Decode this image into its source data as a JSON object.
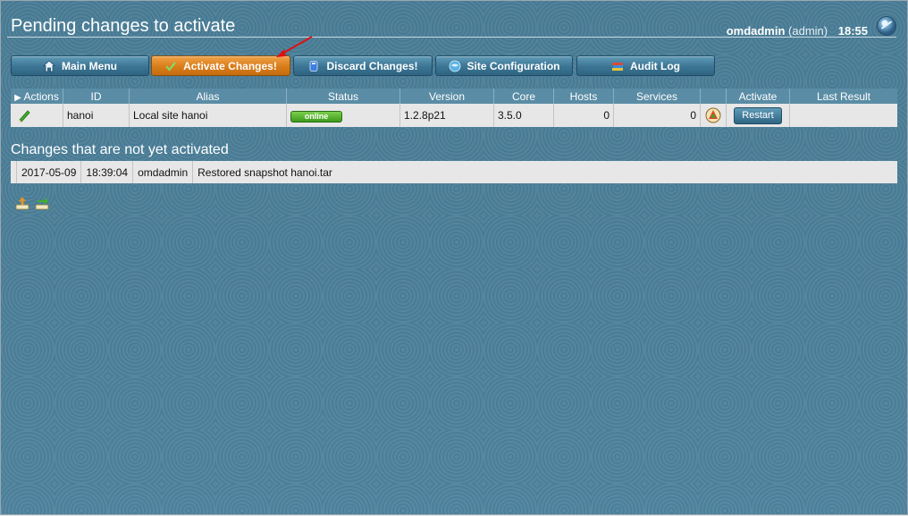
{
  "page": {
    "title": "Pending changes to activate",
    "user": "omdadmin",
    "role": "(admin)",
    "time": "18:55"
  },
  "buttons": [
    {
      "label": "Main Menu",
      "icon": "home-icon"
    },
    {
      "label": "Activate Changes!",
      "icon": "checkmark-icon",
      "active": true
    },
    {
      "label": "Discard Changes!",
      "icon": "discard-icon"
    },
    {
      "label": "Site Configuration",
      "icon": "site-config-icon"
    },
    {
      "label": "Audit Log",
      "icon": "audit-log-icon"
    }
  ],
  "sites_table": {
    "headers": [
      "Actions",
      "ID",
      "Alias",
      "Status",
      "Version",
      "Core",
      "Hosts",
      "Services",
      "",
      "Activate",
      "Last Result"
    ],
    "rows": [
      {
        "id": "hanoi",
        "alias": "Local site hanoi",
        "status": "online",
        "version": "1.2.8p21",
        "core": "3.5.0",
        "hosts": "0",
        "services": "0",
        "activate_button": "Restart",
        "last_result": ""
      }
    ]
  },
  "changes": {
    "title": "Changes that are not yet activated",
    "rows": [
      {
        "date": "2017-05-09",
        "time": "18:39:04",
        "user": "omdadmin",
        "text": "Restored snapshot hanoi.tar"
      }
    ]
  },
  "colors": {
    "background": "#4c7f99",
    "button": "#3c7593",
    "active_button": "#d97d1a",
    "status_online": "#3c9b1c"
  }
}
